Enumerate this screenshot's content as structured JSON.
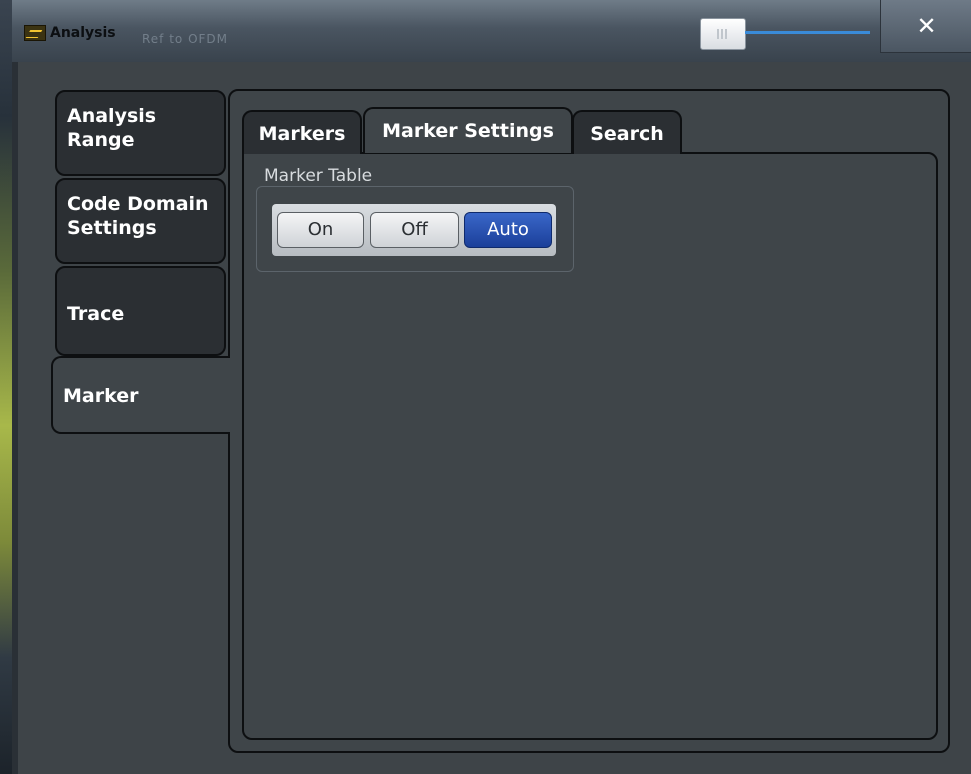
{
  "window": {
    "title": "Analysis",
    "close_glyph": "✕",
    "app_icon": "analyzer-app-icon",
    "background_hint": "Ref to OFDM"
  },
  "side_tabs": [
    {
      "label": "Analysis Range",
      "active": false
    },
    {
      "label": "Code Domain Settings",
      "active": false
    },
    {
      "label": "Trace",
      "active": false
    },
    {
      "label": "Marker",
      "active": true
    }
  ],
  "top_tabs": [
    {
      "label": "Markers",
      "active": false
    },
    {
      "label": "Marker Settings",
      "active": true
    },
    {
      "label": "Search",
      "active": false
    }
  ],
  "marker_table": {
    "label": "Marker Table",
    "options": [
      "On",
      "Off",
      "Auto"
    ],
    "selected": "Auto"
  },
  "colors": {
    "selected_button": "#2a51b5",
    "panel_bg": "#3f4549",
    "tab_bg": "#2b2f33"
  }
}
